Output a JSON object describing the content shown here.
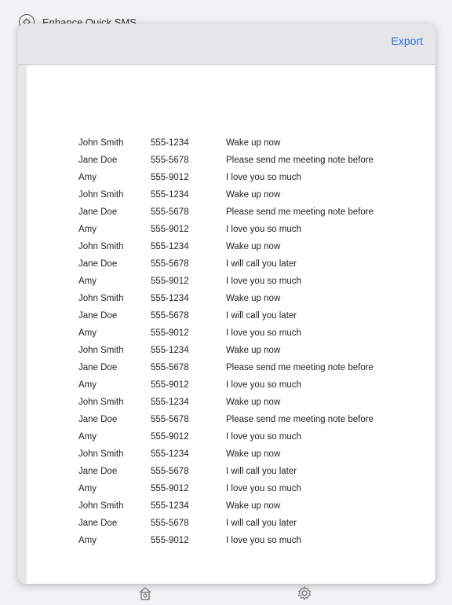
{
  "background": {
    "app_title": "Enhance Quick SMS"
  },
  "sheet": {
    "export_label": "Export"
  },
  "messages": [
    {
      "name": "John Smith",
      "phone": "555-1234",
      "message": "Wake up now"
    },
    {
      "name": "Jane Doe",
      "phone": "555-5678",
      "message": "Please send me meeting note before"
    },
    {
      "name": "Amy",
      "phone": "555-9012",
      "message": "I love you so much"
    },
    {
      "name": "John Smith",
      "phone": "555-1234",
      "message": "Wake up now"
    },
    {
      "name": "Jane Doe",
      "phone": "555-5678",
      "message": "Please send me meeting note before"
    },
    {
      "name": "Amy",
      "phone": "555-9012",
      "message": "I love you so much"
    },
    {
      "name": "John Smith",
      "phone": "555-1234",
      "message": "Wake up now"
    },
    {
      "name": "Jane Doe",
      "phone": "555-5678",
      "message": "I will call you later"
    },
    {
      "name": "Amy",
      "phone": "555-9012",
      "message": "I love you so much"
    },
    {
      "name": "John Smith",
      "phone": "555-1234",
      "message": "Wake up now"
    },
    {
      "name": "Jane Doe",
      "phone": "555-5678",
      "message": "I will call you later"
    },
    {
      "name": "Amy",
      "phone": "555-9012",
      "message": "I love you so much"
    },
    {
      "name": "John Smith",
      "phone": "555-1234",
      "message": "Wake up now"
    },
    {
      "name": "Jane Doe",
      "phone": "555-5678",
      "message": "Please send me meeting note before"
    },
    {
      "name": "Amy",
      "phone": "555-9012",
      "message": "I love you so much"
    },
    {
      "name": "John Smith",
      "phone": "555-1234",
      "message": "Wake up now"
    },
    {
      "name": "Jane Doe",
      "phone": "555-5678",
      "message": "Please send me meeting note before"
    },
    {
      "name": "Amy",
      "phone": "555-9012",
      "message": "I love you so much"
    },
    {
      "name": "John Smith",
      "phone": "555-1234",
      "message": "Wake up now"
    },
    {
      "name": "Jane Doe",
      "phone": "555-5678",
      "message": "I will call you later"
    },
    {
      "name": "Amy",
      "phone": "555-9012",
      "message": "I love you so much"
    },
    {
      "name": "John Smith",
      "phone": "555-1234",
      "message": "Wake up now"
    },
    {
      "name": "Jane Doe",
      "phone": "555-5678",
      "message": "I will call you later"
    },
    {
      "name": "Amy",
      "phone": "555-9012",
      "message": "I love you so much"
    }
  ],
  "tabbar": {
    "icons": [
      "home-icon",
      "gear-icon"
    ]
  },
  "colors": {
    "accent": "#2f6fd6",
    "sheet_bg": "#e6e6e8",
    "paper_bg": "#ffffff"
  }
}
